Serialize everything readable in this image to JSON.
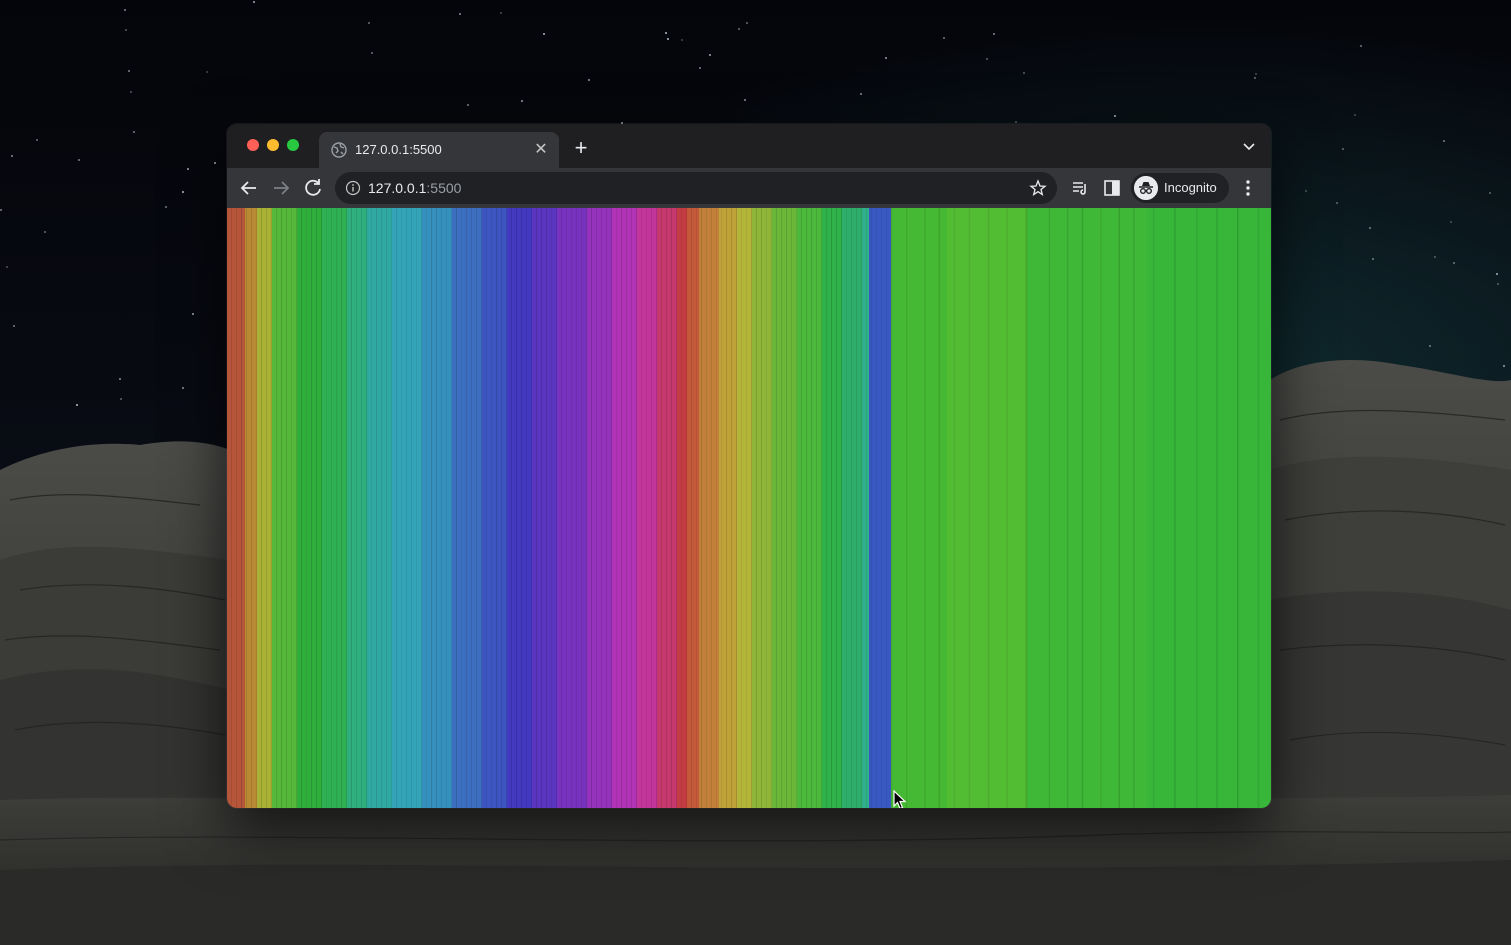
{
  "colors": {
    "tabstrip_bg": "#1f1f22",
    "toolbar_bg": "#35363a",
    "omnibox_bg": "#202124",
    "text": "#e8eaed",
    "muted_text": "#9aa0a6"
  },
  "window": {
    "tab": {
      "title": "127.0.0.1:5500",
      "icon": "globe-icon"
    }
  },
  "toolbar": {
    "url_host": "127.0.0.1",
    "url_port": ":5500",
    "profile_label": "Incognito"
  },
  "content": {
    "description_colors": [
      "#b5553a",
      "#b98a34",
      "#a9b235",
      "#56b83a",
      "#2fae3c",
      "#2fb055",
      "#2fae7e",
      "#31a9a3",
      "#33a4b8",
      "#3590bd",
      "#3c6fc0",
      "#3d55c1",
      "#4338c0",
      "#5a35bf",
      "#7733be",
      "#9633bd",
      "#b134b6",
      "#c2359b",
      "#c5396e",
      "#c43c43",
      "#c4593a",
      "#c2803a",
      "#bfa339",
      "#b3b538",
      "#8fb639",
      "#6bb73a",
      "#4cb83c",
      "#2fb24a",
      "#2eae6a",
      "#2fb08a",
      "#3a58c2",
      "#46b934",
      "#52bc33",
      "#3fb837",
      "#37b63a"
    ]
  }
}
